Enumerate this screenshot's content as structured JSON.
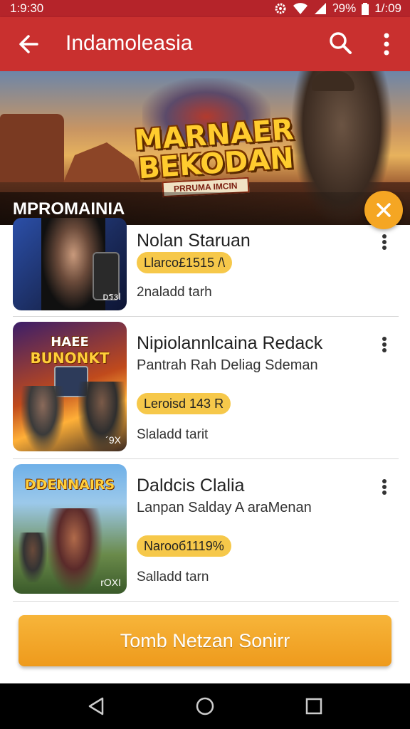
{
  "status_bar": {
    "time": "1:9:30",
    "battery_text": "ʔ9%",
    "right_time": "1/:09",
    "icons": [
      "settings-icon",
      "wifi-icon",
      "signal-icon",
      "battery-icon"
    ]
  },
  "app_bar": {
    "title": "Indamoleasia",
    "icons": [
      "back-arrow-icon",
      "search-icon",
      "more-vert-icon"
    ]
  },
  "banner": {
    "logo_line1": "MARNAER",
    "logo_line2": "BEKODAN",
    "logo_tag": "PRRUMA IMCIN",
    "label": "MPROMAINIA",
    "close_icon": "close-icon"
  },
  "items": [
    {
      "name": "Nolan Staruan",
      "subtitle": "",
      "badge": "Llarco£1515 /\\",
      "meta": "2naladd tarh",
      "thumb_caption": "ᴅรзΙ",
      "thumb_title": "",
      "thumb_title2": ""
    },
    {
      "name": "Nipiolannlcaina Redack",
      "subtitle": "Pantrah Rah Deliag Sdeman",
      "badge": "Leroisd 143 R",
      "meta": "Slaladd tarit",
      "thumb_caption": "´9X",
      "thumb_title": "HAEE",
      "thumb_title2": "BUNONKT"
    },
    {
      "name": "Daldcis Clalia",
      "subtitle": "Lanpan Salday A araMenan",
      "badge": "Narooб1119%",
      "meta": "Salladd tarn",
      "thumb_caption": "rOXI",
      "thumb_title": "",
      "thumb_title2": "DDENNAIRS"
    }
  ],
  "cta": {
    "label": "Tomb Netzan Sonirr"
  },
  "nav_bar": {
    "icons": [
      "nav-back-icon",
      "nav-home-icon",
      "nav-recents-icon"
    ]
  },
  "colors": {
    "primary": "#c9302f",
    "status_bar": "#b5242a",
    "accent": "#f5a623",
    "badge": "#f6c84a",
    "nav_bar": "#000000"
  }
}
